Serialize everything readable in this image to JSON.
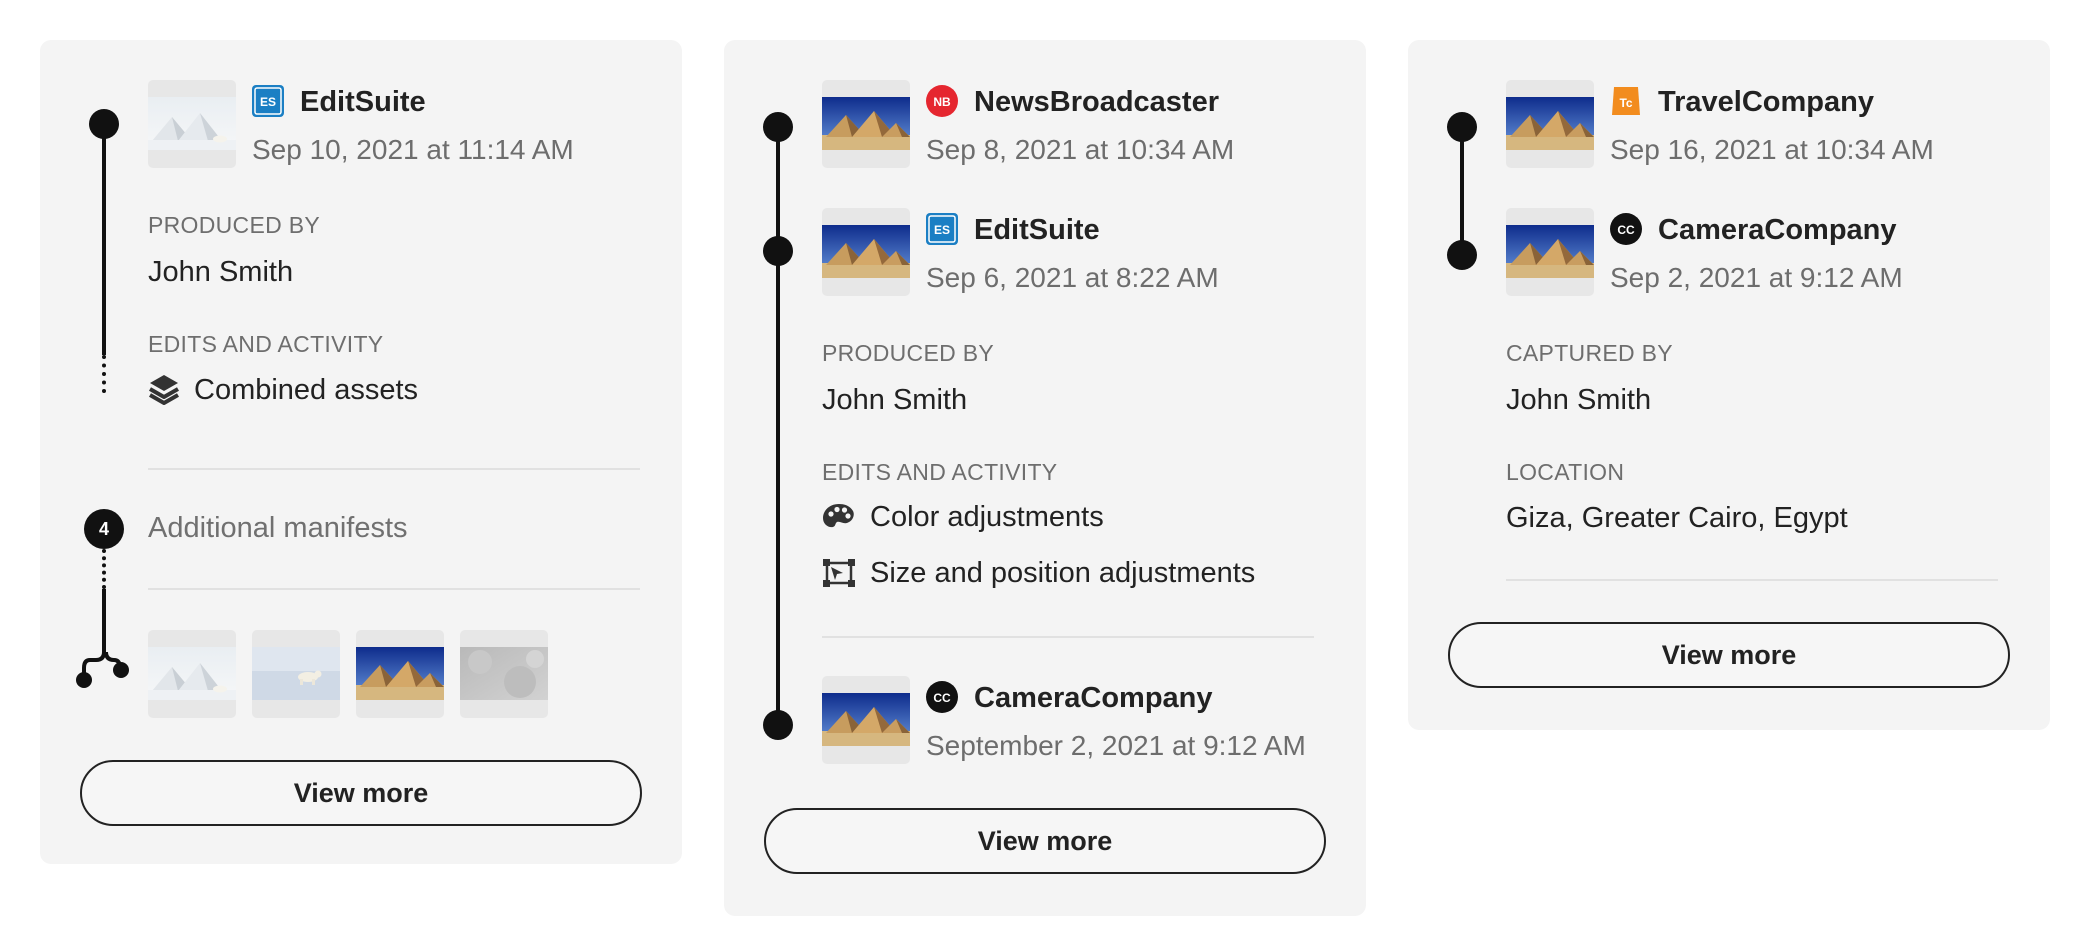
{
  "cards": [
    {
      "manifest": {
        "company": "EditSuite",
        "badge": "ES",
        "date": "Sep 10, 2021 at 11:14 AM"
      },
      "produced_by_label": "PRODUCED BY",
      "produced_by": "John Smith",
      "edits_label": "EDITS AND ACTIVITY",
      "activities": [
        {
          "icon": "layers-icon",
          "label": "Combined assets"
        }
      ],
      "additional": {
        "count": "4",
        "label": "Additional manifests"
      },
      "button": "View more"
    },
    {
      "manifests": [
        {
          "company": "NewsBroadcaster",
          "badge": "NB",
          "date": "Sep 8, 2021 at 10:34 AM"
        },
        {
          "company": "EditSuite",
          "badge": "ES",
          "date": "Sep 6, 2021 at 8:22 AM"
        },
        {
          "company": "CameraCompany",
          "badge": "CC",
          "date": "September 2, 2021 at 9:12 AM"
        }
      ],
      "produced_by_label": "PRODUCED BY",
      "produced_by": "John Smith",
      "edits_label": "EDITS AND ACTIVITY",
      "activities": [
        {
          "icon": "palette-icon",
          "label": "Color adjustments"
        },
        {
          "icon": "transform-icon",
          "label": "Size and position adjustments"
        }
      ],
      "button": "View more"
    },
    {
      "manifests": [
        {
          "company": "TravelCompany",
          "badge": "Tc",
          "date": "Sep 16, 2021 at 10:34 AM"
        },
        {
          "company": "CameraCompany",
          "badge": "CC",
          "date": "Sep 2, 2021 at 9:12 AM"
        }
      ],
      "captured_by_label": "CAPTURED BY",
      "captured_by": "John Smith",
      "location_label": "LOCATION",
      "location": "Giza, Greater Cairo, Egypt",
      "button": "View more"
    }
  ],
  "colors": {
    "card_bg": "#f4f4f4",
    "editsuite_badge": "#1b7fc4",
    "newsbroadcaster_badge": "#e5262f",
    "travelcompany_badge": "#f28c1e",
    "cameracompany_badge": "#111111"
  }
}
